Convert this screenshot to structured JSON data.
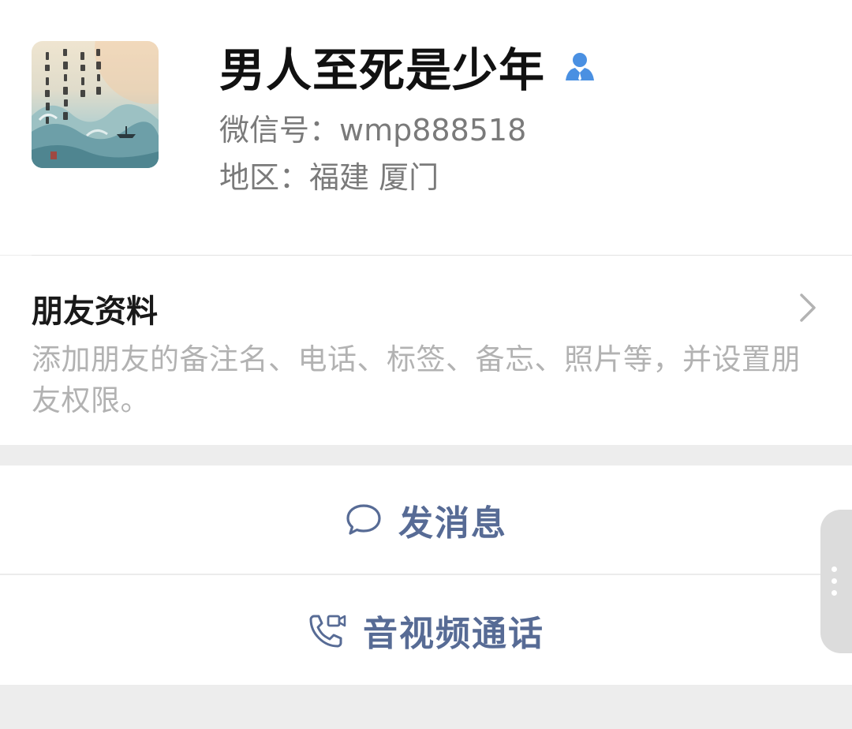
{
  "profile": {
    "nickname": "男人至死是少年",
    "wechat_id": "微信号：wmp888518",
    "region": "地区：福建 厦门",
    "avatar_icon": "ink-painting-avatar",
    "badge_icon": "contact-person-icon",
    "badge_color": "#4a90e2"
  },
  "friend_profile": {
    "title": "朋友资料",
    "description": "添加朋友的备注名、电话、标签、备忘、照片等，并设置朋友权限。",
    "chevron_icon": "chevron-right-icon"
  },
  "actions": {
    "message_label": "发消息",
    "message_icon": "chat-bubble-icon",
    "call_label": "音视频通话",
    "call_icon": "phone-video-icon",
    "accent_color": "#576b95"
  },
  "floating_handle": {
    "icon": "more-vertical-icon"
  }
}
